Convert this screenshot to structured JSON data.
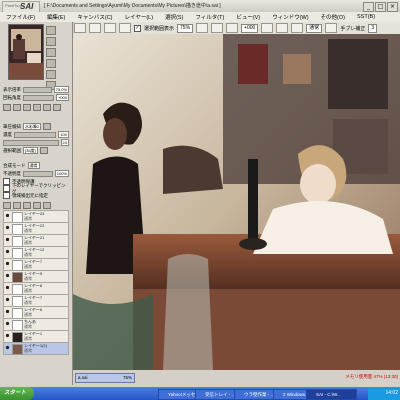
{
  "app": {
    "logo_text": "PaintTool",
    "logo_brand": "SAI",
    "title_path": "[ F:\\Documents and Settings\\Ayumi\\My Documents\\My Pictures\\描き途中\\a.sai ]"
  },
  "menu": [
    "ファイル(F)",
    "編集(E)",
    "キャンバス(C)",
    "レイヤー(L)",
    "選択(S)",
    "フィルタ(T)",
    "ビュー(V)",
    "ウィンドウ(W)",
    "その他(O)",
    "SST(B)"
  ],
  "toolbar": {
    "select_label": "選択範囲表示",
    "zoom": "75%",
    "rotation": "+000",
    "mode": "通常",
    "stabilizer_label": "手ブレ補正",
    "stabilizer_value": "3"
  },
  "panel": {
    "zoom_label": "表示倍率",
    "zoom_value": "75.0%",
    "rotate_label": "回転角度",
    "rotate_value": "+000",
    "brush_label": "筆圧検知",
    "brush_value": "水彩筆2",
    "density_label": "濃度",
    "density_value": "100",
    "size_value": "24",
    "preset_label": "選択範囲",
    "preset_value": "[35度]",
    "blend_label": "合成モード",
    "blend_value": "通常",
    "opacity_label": "不透明度",
    "opacity_value": "100%",
    "protect_label": "不透明保護",
    "clip_label": "下のレイヤーでクリッピング",
    "ref_label": "領域検出元に指定"
  },
  "layers": [
    {
      "name": "レイヤー23",
      "mode": "通常",
      "opacity": "100%"
    },
    {
      "name": "レイヤー22",
      "mode": "通常",
      "opacity": "100%"
    },
    {
      "name": "レイヤー21",
      "mode": "通常",
      "opacity": "100%"
    },
    {
      "name": "レイヤー12",
      "mode": "通常",
      "opacity": "100%"
    },
    {
      "name": "レイヤー7",
      "mode": "通常",
      "opacity": "100%"
    },
    {
      "name": "レイヤー5",
      "mode": "通常",
      "opacity": "100%"
    },
    {
      "name": "レイヤー8",
      "mode": "通常",
      "opacity": "100%"
    },
    {
      "name": "レイヤー7",
      "mode": "通常",
      "opacity": "100%"
    },
    {
      "name": "レイヤー6",
      "mode": "通常",
      "opacity": "100%"
    },
    {
      "name": "ちんあ",
      "mode": "通常",
      "opacity": "100%"
    },
    {
      "name": "レイヤー1",
      "mode": "通常",
      "opacity": "100%"
    },
    {
      "name": "レイヤー1(2)",
      "mode": "通常",
      "opacity": "100%"
    }
  ],
  "status": {
    "doc_tab": "a.sai",
    "doc_zoom": "75%",
    "memory": "メモリ使用量 47% (13:30)"
  },
  "taskbar": {
    "start": "スタート",
    "tasks": [
      "Yahoo!メッセ",
      "受信トレイ - ...",
      "ウラ壁作業 - ...",
      "2 Windows...",
      "SAI - C:\\W..."
    ],
    "clock": "14:02",
    "clock_day": "水曜日"
  },
  "colors": {
    "taskbar": "#2456c8",
    "selected_layer": "#b9c6e6"
  }
}
